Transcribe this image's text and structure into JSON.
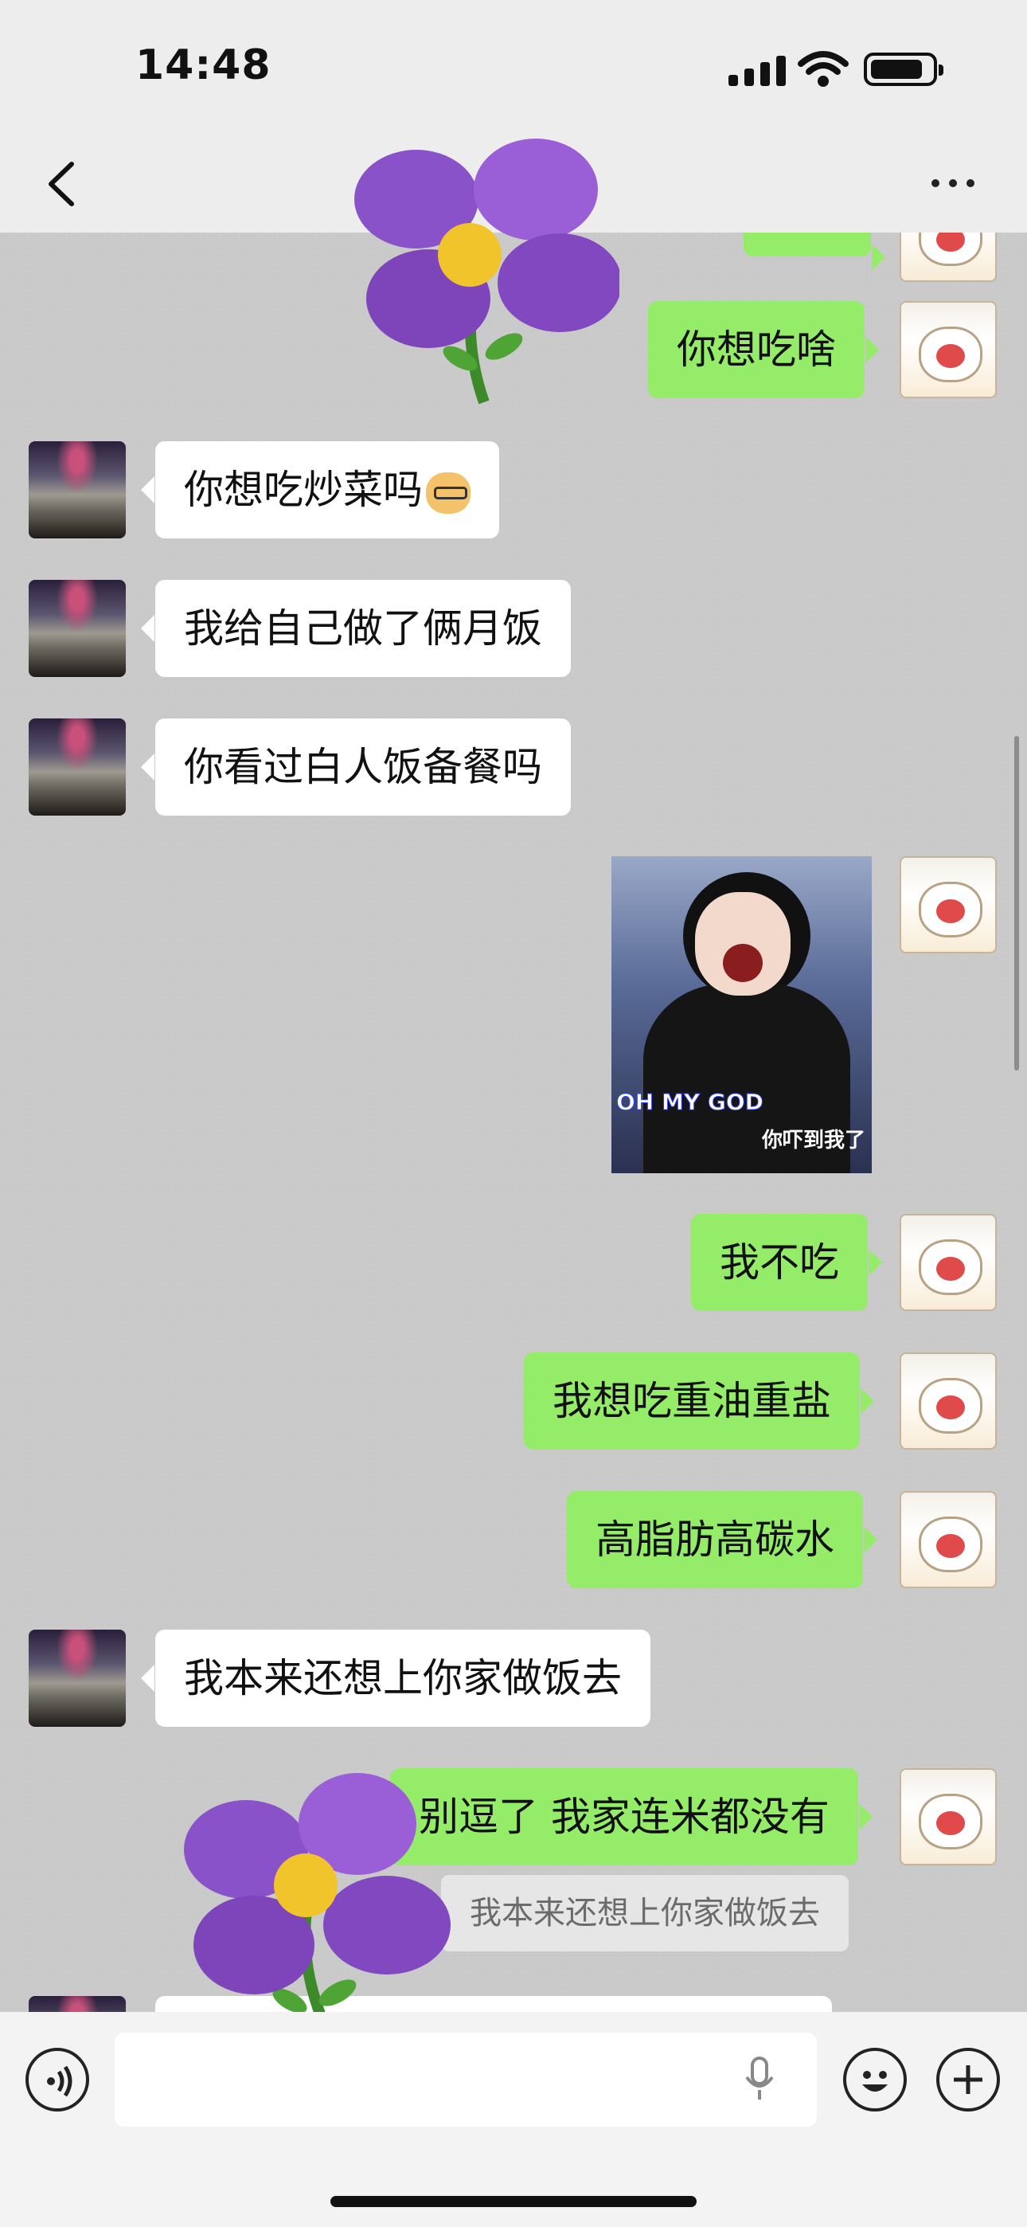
{
  "status_bar": {
    "time": "14:48"
  },
  "chat": {
    "messages": [
      {
        "side": "right",
        "text": ""
      },
      {
        "side": "right",
        "text": "你想吃啥"
      },
      {
        "side": "left",
        "text": "你想吃炒菜吗"
      },
      {
        "side": "left",
        "text": "我给自己做了俩月饭"
      },
      {
        "side": "left",
        "text": "你看过白人饭备餐吗"
      },
      {
        "side": "right",
        "type": "image",
        "caption_line1": "OH MY GOD",
        "caption_line2": "你吓到我了"
      },
      {
        "side": "right",
        "text": "我不吃"
      },
      {
        "side": "right",
        "text": "我想吃重油重盐"
      },
      {
        "side": "right",
        "text": "高脂肪高碳水"
      },
      {
        "side": "left",
        "text": "我本来还想上你家做饭去"
      },
      {
        "side": "right",
        "text": "别逗了 我家连米都没有",
        "quote": "我本来还想上你家做饭去"
      },
      {
        "side": "left",
        "text": ""
      }
    ]
  },
  "colors": {
    "sent_bubble": "#95ec69",
    "received_bubble": "#ffffff",
    "chat_bg": "#cacaca"
  }
}
